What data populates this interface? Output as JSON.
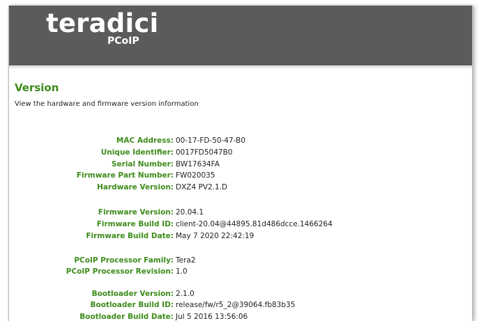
{
  "header": {
    "brand": "teradici",
    "brand_mark": "®",
    "product": "PCoIP"
  },
  "page": {
    "title": "Version",
    "subtitle": "View the hardware and firmware version information"
  },
  "version_info": [
    {
      "label": "MAC Address:",
      "value": "00-17-FD-50-47-B0"
    },
    {
      "label": "Unique Identifier:",
      "value": "0017FD5047B0"
    },
    {
      "label": "Serial Number:",
      "value": "BW17634FA"
    },
    {
      "label": "Firmware Part Number:",
      "value": "FW020035"
    },
    {
      "label": "Hardware Version:",
      "value": "DXZ4 PV2.1.D"
    },
    {
      "label": "Firmware Version:",
      "value": "20.04.1"
    },
    {
      "label": "Firmware Build ID:",
      "value": "client-20.04@44895.81d486dcce.1466264"
    },
    {
      "label": "Firmware Build Date:",
      "value": "May 7 2020 22:42:19"
    },
    {
      "label": "PCoIP Processor Family:",
      "value": "Tera2"
    },
    {
      "label": "PCoIP Processor Revision:",
      "value": "1.0"
    },
    {
      "label": "Bootloader Version:",
      "value": "2.1.0"
    },
    {
      "label": "Bootloader Build ID:",
      "value": "release/fw/r5_2@39064.fb83b35"
    },
    {
      "label": "Bootloader Build Date:",
      "value": "Jul 5 2016 13:56:06"
    }
  ]
}
